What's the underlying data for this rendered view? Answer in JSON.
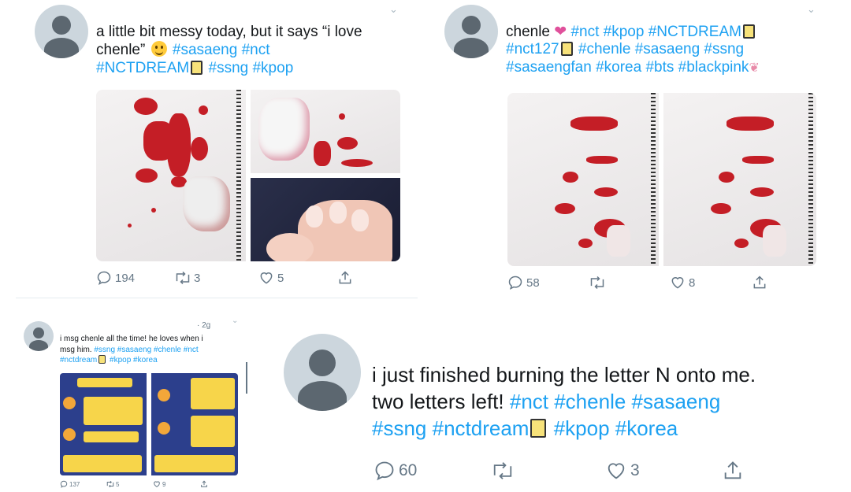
{
  "tweet1": {
    "text_plain": "a little bit messy today, but it says “i love chenle”",
    "hashtags_line1": "#sasaeng #nct",
    "hashtags_line2a": "#NCTDREAM",
    "hashtags_line2b": "#ssng #kpop",
    "reply_count": "194",
    "retweet_count": "3",
    "like_count": "5"
  },
  "tweet2": {
    "name": "chenle",
    "tags_line1": "#nct #kpop #NCTDREAM",
    "tags_line2a": "#nct127",
    "tags_line2b": "#chenle #sasaeng #ssng",
    "tags_line3": "#sasaengfan #korea #bts #blackpink",
    "reply_count": "58",
    "retweet_count": "",
    "like_count": "8"
  },
  "tweet3": {
    "time": "· 2g",
    "text_line1": "i msg chenle all the time! he loves when i",
    "text_line2": "msg him.",
    "tags_line2": "#ssng #sasaeng #chenle #nct",
    "tags_line3a": "#nctdream",
    "tags_line3b": "#kpop #korea",
    "reply_count": "137",
    "retweet_count": "5",
    "like_count": "9"
  },
  "tweet4": {
    "text_line1": "i just finished burning the letter N onto me.",
    "text_line2": "two letters left!",
    "tags_line2": "#nct #chenle #sasaeng",
    "tags_line3a": "#ssng #nctdream",
    "tags_line3b": "#kpop #korea",
    "reply_count": "60",
    "retweet_count": "",
    "like_count": "3"
  },
  "icons": {
    "reply": "reply-icon",
    "retweet": "retweet-icon",
    "like": "like-icon",
    "share": "share-icon",
    "caret": "chevron-down-icon"
  },
  "colors": {
    "hashtag": "#1da1f2",
    "icon_gray": "#657786",
    "avatar_bg": "#ccd6dd",
    "avatar_fg": "#5c6770"
  }
}
